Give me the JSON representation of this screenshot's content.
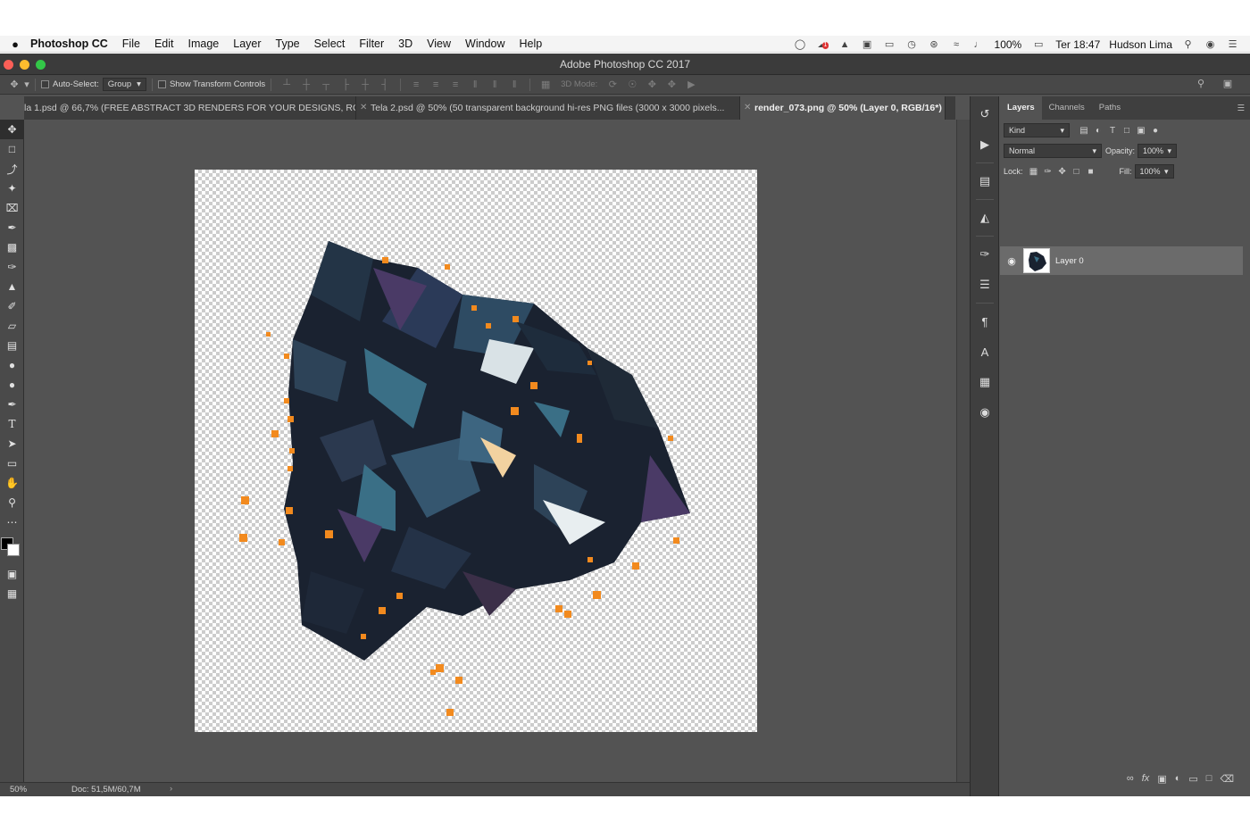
{
  "menubar": {
    "app_name": "Photoshop CC",
    "menus": [
      "File",
      "Edit",
      "Image",
      "Layer",
      "Type",
      "Select",
      "Filter",
      "3D",
      "View",
      "Window",
      "Help"
    ],
    "battery": "100%",
    "clock": "Ter 18:47",
    "user": "Hudson Lima",
    "badge_count": "1"
  },
  "window": {
    "title": "Adobe Photoshop CC 2017",
    "lights": [
      "#fc5f57",
      "#fdbc2e",
      "#33c748"
    ]
  },
  "options": {
    "auto_select_label": "Auto-Select:",
    "auto_select_value": "Group",
    "transform_label": "Show Transform Controls",
    "mode_3d_label": "3D Mode:"
  },
  "tabs": [
    {
      "label": "la 1.psd @ 66,7% (FREE ABSTRACT 3D RENDERS FOR YOUR DESIGNS, RGB/..."
    },
    {
      "label": "Tela 2.psd @ 50% (50 transparent background hi-res PNG files (3000 x 3000 pixels..."
    },
    {
      "label": "render_073.png @ 50% (Layer 0, RGB/16*)"
    }
  ],
  "tools": [
    "move-tool",
    "marquee-tool",
    "lasso-tool",
    "magic-wand-tool",
    "crop-tool",
    "eyedropper-tool",
    "healing-brush-tool",
    "brush-tool",
    "clone-stamp-tool",
    "history-brush-tool",
    "eraser-tool",
    "gradient-tool",
    "blur-tool",
    "dodge-tool",
    "pen-tool",
    "type-tool",
    "path-selection-tool",
    "rectangle-tool",
    "hand-tool",
    "zoom-tool",
    "more-tools"
  ],
  "status": {
    "zoom": "50%",
    "doc_size": "Doc: 51,5M/60,7M"
  },
  "layers_panel": {
    "tabs": [
      "Layers",
      "Channels",
      "Paths"
    ],
    "filter_kind": "Kind",
    "blend_mode": "Normal",
    "opacity_label": "Opacity:",
    "opacity_value": "100%",
    "lock_label": "Lock:",
    "fill_label": "Fill:",
    "fill_value": "100%",
    "layers": [
      {
        "name": "Layer 0"
      }
    ]
  },
  "colors": {
    "accent_orange": "#f28a1e",
    "crystal_dark": "#1c2430",
    "crystal_teal": "#3a6f86",
    "crystal_purple": "#4a3a66"
  }
}
